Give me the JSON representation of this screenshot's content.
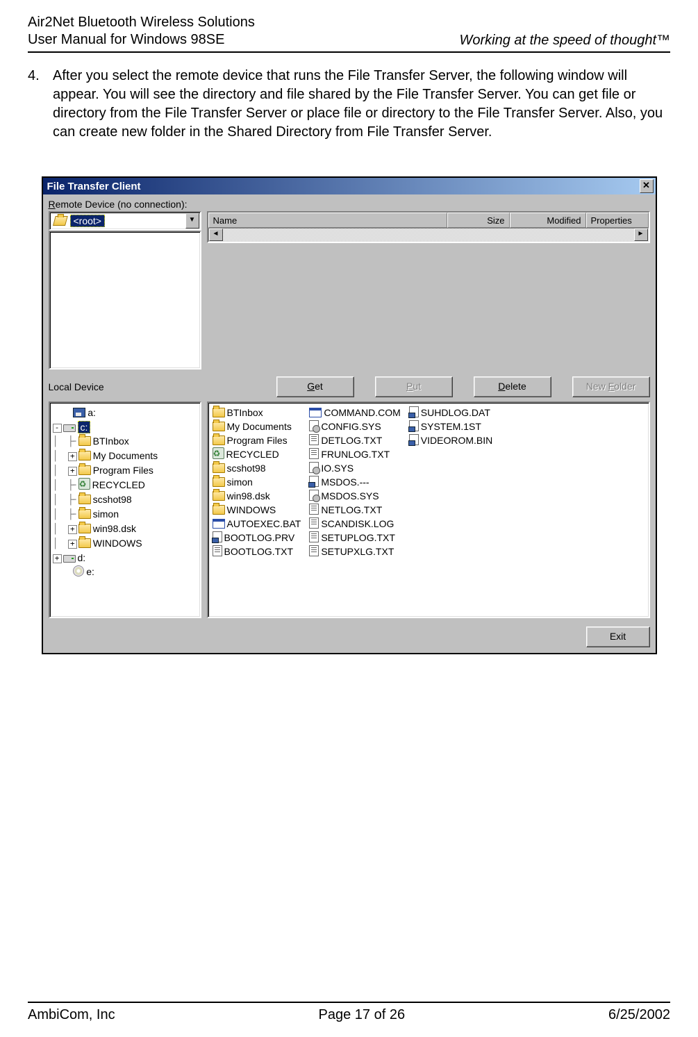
{
  "header": {
    "left_line1": "Air2Net Bluetooth Wireless Solutions",
    "left_line2": "User Manual for Windows 98SE",
    "right": "Working at the speed of thought™"
  },
  "step": {
    "num": "4.",
    "text": "After you select the remote device that runs the File Transfer Server, the following window will appear. You will see the directory and file shared by the File Transfer Server. You can get file or directory from the File Transfer Server or place file or directory to the File Transfer Server. Also, you can create new folder in the Shared Directory from File Transfer Server."
  },
  "window": {
    "title": "File Transfer Client",
    "remote_label_pre": "R",
    "remote_label_rest": "emote Device (no connection):",
    "local_label": "Local Device",
    "root_sel": "<root>",
    "list_headers": {
      "name": "Name",
      "size": "Size",
      "modified": "Modified",
      "properties": "Properties"
    },
    "buttons": {
      "get": "Get",
      "put": "Put",
      "delete": "Delete",
      "newfolder": "New Folder",
      "exit": "Exit"
    },
    "buttons_hot": {
      "get": "G",
      "put": "P",
      "delete": "D",
      "newfolder": "F"
    },
    "tree": {
      "a": "a:",
      "c": "c:",
      "c_children": [
        "BTInbox",
        "My Documents",
        "Program Files",
        "RECYCLED",
        "scshot98",
        "simon",
        "win98.dsk",
        "WINDOWS"
      ],
      "d": "d:",
      "e": "e:"
    },
    "files_col1": [
      {
        "i": "folder",
        "n": "BTInbox"
      },
      {
        "i": "folder",
        "n": "My Documents"
      },
      {
        "i": "folder",
        "n": "Program Files"
      },
      {
        "i": "recycle",
        "n": "RECYCLED"
      },
      {
        "i": "folder",
        "n": "scshot98"
      },
      {
        "i": "folder",
        "n": "simon"
      },
      {
        "i": "folder",
        "n": "win98.dsk"
      },
      {
        "i": "folder",
        "n": "WINDOWS"
      },
      {
        "i": "exe",
        "n": "AUTOEXEC.BAT"
      },
      {
        "i": "dat",
        "n": "BOOTLOG.PRV"
      },
      {
        "i": "txt",
        "n": "BOOTLOG.TXT"
      }
    ],
    "files_col2": [
      {
        "i": "exe",
        "n": "COMMAND.COM"
      },
      {
        "i": "sys",
        "n": "CONFIG.SYS"
      },
      {
        "i": "txt",
        "n": "DETLOG.TXT"
      },
      {
        "i": "txt",
        "n": "FRUNLOG.TXT"
      },
      {
        "i": "sys",
        "n": "IO.SYS"
      },
      {
        "i": "dat",
        "n": "MSDOS.---"
      },
      {
        "i": "sys",
        "n": "MSDOS.SYS"
      },
      {
        "i": "txt",
        "n": "NETLOG.TXT"
      },
      {
        "i": "txt",
        "n": "SCANDISK.LOG"
      },
      {
        "i": "txt",
        "n": "SETUPLOG.TXT"
      },
      {
        "i": "txt",
        "n": "SETUPXLG.TXT"
      }
    ],
    "files_col3": [
      {
        "i": "dat",
        "n": "SUHDLOG.DAT"
      },
      {
        "i": "dat",
        "n": "SYSTEM.1ST"
      },
      {
        "i": "dat",
        "n": "VIDEOROM.BIN"
      }
    ]
  },
  "footer": {
    "left": "AmbiCom, Inc",
    "center": "Page 17 of 26",
    "right": "6/25/2002"
  }
}
